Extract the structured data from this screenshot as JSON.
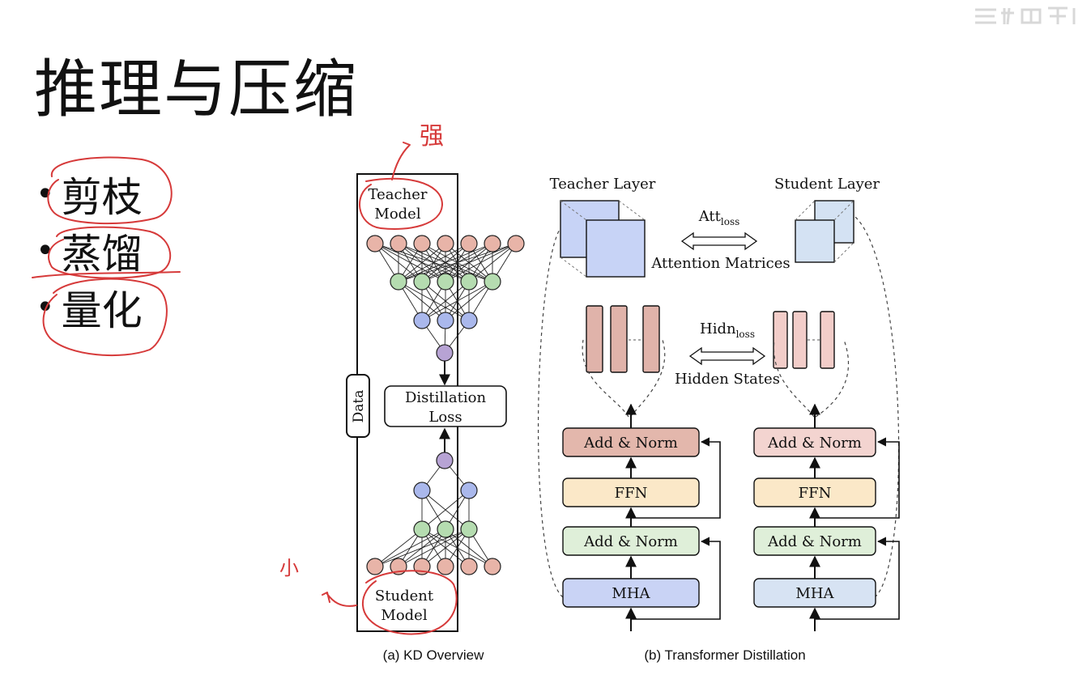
{
  "slide": {
    "title": "推理与压缩",
    "bullets": [
      {
        "label": "剪枝"
      },
      {
        "label": "蒸馏"
      },
      {
        "label": "量化"
      }
    ],
    "annotations": {
      "strong_label": "强",
      "small_label": "小"
    }
  },
  "diagram": {
    "kd": {
      "teacher_line1": "Teacher",
      "teacher_line2": "Model",
      "student_line1": "Student",
      "student_line2": "Model",
      "data_label": "Data",
      "loss_line1": "Distillation",
      "loss_line2": "Loss",
      "caption": "(a) KD Overview"
    },
    "transformer": {
      "teacher_layer": "Teacher Layer",
      "student_layer": "Student Layer",
      "att_main": "Att",
      "att_sub": "loss",
      "attention_matrices": "Attention Matrices",
      "hidn_main": "Hidn",
      "hidn_sub": "loss",
      "hidden_states": "Hidden States",
      "add_norm": "Add & Norm",
      "ffn": "FFN",
      "mha": "MHA",
      "caption": "(b) Transformer Distillation"
    },
    "colors": {
      "teacher_node": "#e8b4a8",
      "hidden_node": "#b5dcb0",
      "blue_node": "#aab8ec",
      "output_node": "#b7a3d4",
      "teacher_addnorm": "#e3b7ac",
      "student_addnorm": "#f3d4d0",
      "ffn": "#fbe8c8",
      "addnorm_green": "#dfefd9",
      "teacher_mha": "#c9d3f5",
      "student_mha": "#d7e3f3",
      "handwriting": "#d63a3a"
    }
  }
}
